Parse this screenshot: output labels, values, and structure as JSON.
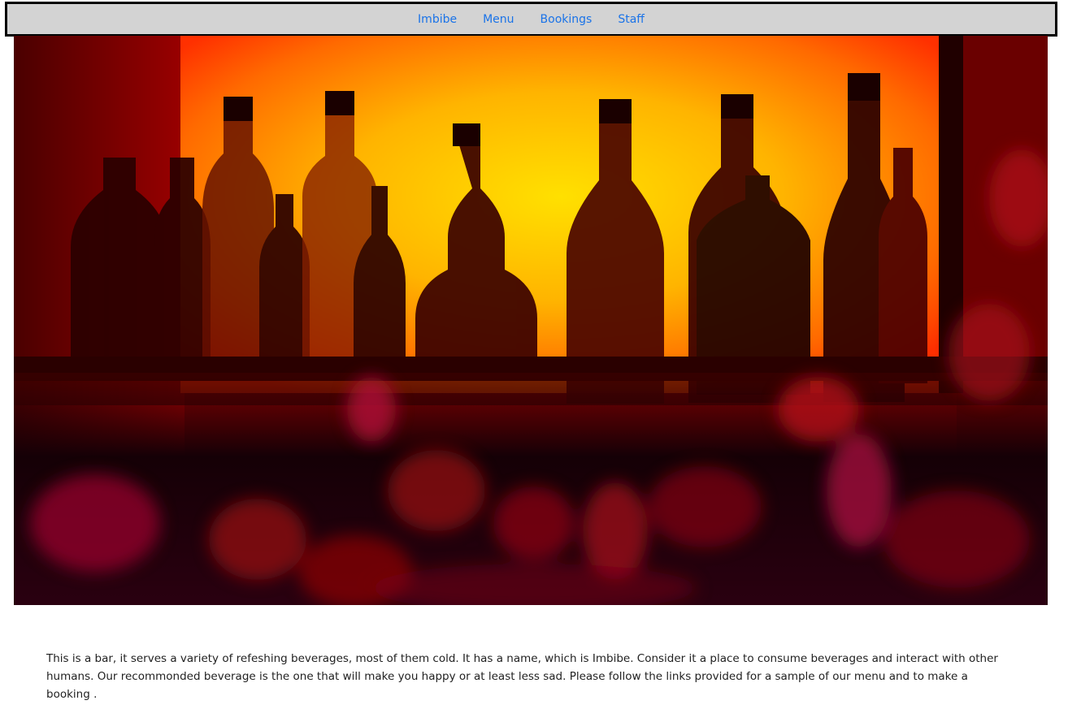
{
  "nav": {
    "links": [
      {
        "label": "Imbibe"
      },
      {
        "label": "Menu"
      },
      {
        "label": "Bookings"
      },
      {
        "label": "Staff"
      }
    ]
  },
  "hero": {
    "description": "bar-shelf-bottles-photo"
  },
  "intro": {
    "text": "This is a bar, it serves a variety of refeshing beverages, most of them cold. It has a name, which is Imbibe. Consider it a place to consume beverages and interact with other humans. Our recommonded beverage is the one that will make you happy or at least less sad. Please follow the links provided for a sample of our menu and to make a booking ."
  },
  "colors": {
    "nav_bg": "#d3d3d3",
    "link": "#1a73e8",
    "glow_center": "#ffd400",
    "glow_edge": "#ff4a00"
  }
}
